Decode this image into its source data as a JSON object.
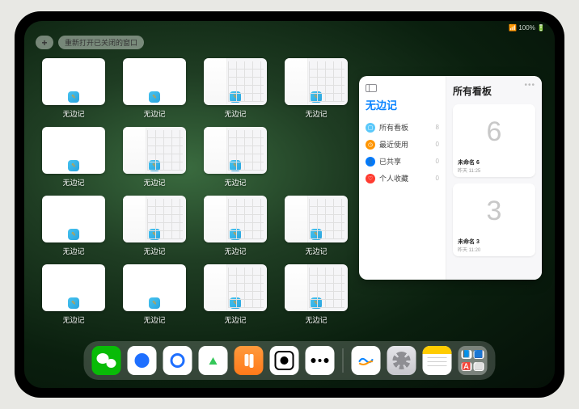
{
  "status": {
    "text": "📶 100% 🔋"
  },
  "controls": {
    "plus": "+",
    "reopen": "重新打开已关闭的窗口"
  },
  "app_label": "无边记",
  "thumbs": [
    {
      "style": "blank"
    },
    {
      "style": "blank"
    },
    {
      "style": "content"
    },
    {
      "style": "content"
    },
    {
      "style": "blank"
    },
    {
      "style": "content"
    },
    {
      "style": "content"
    },
    null,
    {
      "style": "blank"
    },
    {
      "style": "content"
    },
    {
      "style": "content"
    },
    {
      "style": "content"
    },
    {
      "style": "blank"
    },
    {
      "style": "blank"
    },
    {
      "style": "content"
    },
    {
      "style": "content"
    }
  ],
  "panel": {
    "title": "无边记",
    "items": [
      {
        "icon": "t",
        "glyph": "▢",
        "label": "所有看板",
        "count": "8"
      },
      {
        "icon": "c",
        "glyph": "◷",
        "label": "最近使用",
        "count": "0"
      },
      {
        "icon": "p",
        "glyph": "👤",
        "label": "已共享",
        "count": "0"
      },
      {
        "icon": "h",
        "glyph": "♡",
        "label": "个人收藏",
        "count": "0"
      }
    ],
    "right_title": "所有看板",
    "boards": [
      {
        "preview": "6",
        "name": "未命名 6",
        "sub": "昨天 11:25"
      },
      {
        "preview": "3",
        "name": "未命名 3",
        "sub": "昨天 11:20"
      }
    ],
    "ellipsis": "•••"
  },
  "dock": {
    "apps": [
      {
        "id": "wechat",
        "name": "wechat-icon"
      },
      {
        "id": "qqhd",
        "name": "qq-hd-icon"
      },
      {
        "id": "qq",
        "name": "qq-browser-icon"
      },
      {
        "id": "media",
        "name": "media-icon"
      },
      {
        "id": "books",
        "name": "books-icon"
      },
      {
        "id": "dice",
        "name": "dice-icon"
      },
      {
        "id": "graph",
        "name": "graph-icon"
      }
    ],
    "recent": [
      {
        "id": "freeform",
        "name": "freeform-icon"
      },
      {
        "id": "settings",
        "name": "settings-icon"
      },
      {
        "id": "notes",
        "name": "notes-icon"
      },
      {
        "id": "folder",
        "name": "app-folder-icon"
      }
    ]
  }
}
